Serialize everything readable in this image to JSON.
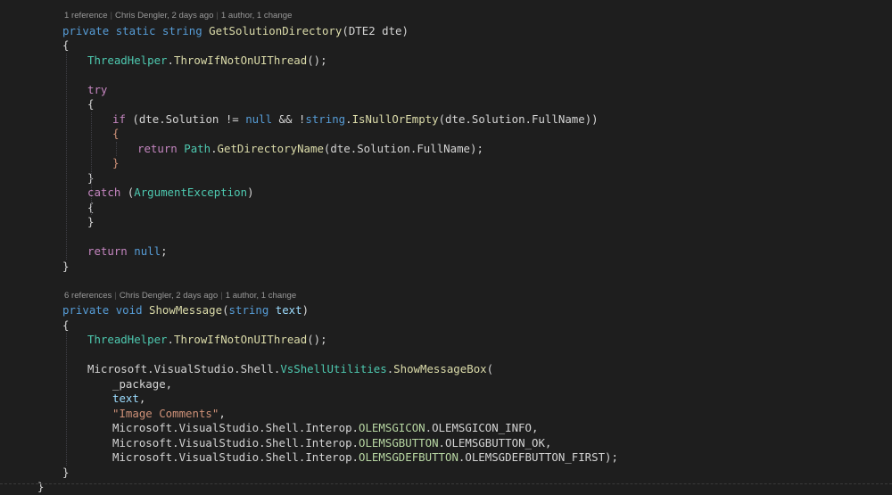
{
  "colors": {
    "background": "#1e1e1e",
    "keyword": "#569cd6",
    "control": "#c586c0",
    "type": "#4ec9b0",
    "enum": "#b8d7a3",
    "method": "#dcdcaa",
    "string": "#ce9178",
    "text": "#d4d4d4",
    "param": "#9cdcfe",
    "lens": "#999999"
  },
  "codelens": [
    {
      "refs": "1 reference",
      "author": "Chris Dengler, 2 days ago",
      "changes": "1 author, 1 change"
    },
    {
      "refs": "6 references",
      "author": "Chris Dengler, 2 days ago",
      "changes": "1 author, 1 change"
    }
  ],
  "lines": [
    {
      "lens": 0
    },
    {
      "indent": 0,
      "tokens": [
        [
          "private",
          "kw"
        ],
        [
          " ",
          "p"
        ],
        [
          "static",
          "kw"
        ],
        [
          " ",
          "p"
        ],
        [
          "string",
          "kw"
        ],
        [
          " ",
          "p"
        ],
        [
          "GetSolutionDirectory",
          "mt"
        ],
        [
          "(",
          "p"
        ],
        [
          "DTE2",
          "p"
        ],
        [
          " dte)",
          "p"
        ]
      ]
    },
    {
      "indent": 0,
      "tokens": [
        [
          "{",
          "p"
        ]
      ]
    },
    {
      "indent": 1,
      "tokens": [
        [
          "ThreadHelper",
          "ty"
        ],
        [
          ".",
          "p"
        ],
        [
          "ThrowIfNotOnUIThread",
          "mt"
        ],
        [
          "();",
          "p"
        ]
      ]
    },
    {
      "indent": 0,
      "tokens": []
    },
    {
      "indent": 1,
      "tokens": [
        [
          "try",
          "ct"
        ]
      ]
    },
    {
      "indent": 1,
      "tokens": [
        [
          "{",
          "p"
        ]
      ]
    },
    {
      "indent": 2,
      "tokens": [
        [
          "if",
          "ct"
        ],
        [
          " (dte.Solution != ",
          "p"
        ],
        [
          "null",
          "kw"
        ],
        [
          " && !",
          "p"
        ],
        [
          "string",
          "kw"
        ],
        [
          ".",
          "p"
        ],
        [
          "IsNullOrEmpty",
          "mt"
        ],
        [
          "(dte.Solution.FullName))",
          "p"
        ]
      ]
    },
    {
      "indent": 2,
      "tokens": [
        [
          "{",
          "br"
        ]
      ]
    },
    {
      "indent": 3,
      "tokens": [
        [
          "return",
          "ct"
        ],
        [
          " ",
          "p"
        ],
        [
          "Path",
          "ty"
        ],
        [
          ".",
          "p"
        ],
        [
          "GetDirectoryName",
          "mt"
        ],
        [
          "(dte.Solution.FullName);",
          "p"
        ]
      ]
    },
    {
      "indent": 2,
      "tokens": [
        [
          "}",
          "br"
        ]
      ]
    },
    {
      "indent": 1,
      "tokens": [
        [
          "}",
          "p"
        ]
      ]
    },
    {
      "indent": 1,
      "tokens": [
        [
          "catch",
          "ct"
        ],
        [
          " (",
          "p"
        ],
        [
          "ArgumentException",
          "ty"
        ],
        [
          ")",
          "p"
        ]
      ]
    },
    {
      "indent": 1,
      "tokens": [
        [
          "{",
          "p"
        ]
      ]
    },
    {
      "indent": 1,
      "tokens": [
        [
          "}",
          "p"
        ]
      ]
    },
    {
      "indent": 0,
      "tokens": []
    },
    {
      "indent": 1,
      "tokens": [
        [
          "return",
          "ct"
        ],
        [
          " ",
          "p"
        ],
        [
          "null",
          "kw"
        ],
        [
          ";",
          "p"
        ]
      ]
    },
    {
      "indent": 0,
      "tokens": [
        [
          "}",
          "p"
        ]
      ]
    },
    {
      "indent": 0,
      "tokens": []
    },
    {
      "lens": 1
    },
    {
      "indent": 0,
      "tokens": [
        [
          "private",
          "kw"
        ],
        [
          " ",
          "p"
        ],
        [
          "void",
          "kw"
        ],
        [
          " ",
          "p"
        ],
        [
          "ShowMessage",
          "mt"
        ],
        [
          "(",
          "p"
        ],
        [
          "string",
          "kw"
        ],
        [
          " ",
          "p"
        ],
        [
          "text",
          "pa"
        ],
        [
          ")",
          "p"
        ]
      ]
    },
    {
      "indent": 0,
      "tokens": [
        [
          "{",
          "p"
        ]
      ]
    },
    {
      "indent": 1,
      "tokens": [
        [
          "ThreadHelper",
          "ty"
        ],
        [
          ".",
          "p"
        ],
        [
          "ThrowIfNotOnUIThread",
          "mt"
        ],
        [
          "();",
          "p"
        ]
      ]
    },
    {
      "indent": 0,
      "tokens": []
    },
    {
      "indent": 1,
      "tokens": [
        [
          "Microsoft.VisualStudio.Shell.",
          "p"
        ],
        [
          "VsShellUtilities",
          "ty"
        ],
        [
          ".",
          "p"
        ],
        [
          "ShowMessageBox",
          "mt"
        ],
        [
          "(",
          "p"
        ]
      ]
    },
    {
      "indent": 2,
      "tokens": [
        [
          "_package,",
          "p"
        ]
      ]
    },
    {
      "indent": 2,
      "tokens": [
        [
          "text",
          "pa"
        ],
        [
          ",",
          "p"
        ]
      ]
    },
    {
      "indent": 2,
      "tokens": [
        [
          "\"Image Comments\"",
          "st"
        ],
        [
          ",",
          "p"
        ]
      ]
    },
    {
      "indent": 2,
      "tokens": [
        [
          "Microsoft.VisualStudio.Shell.Interop.",
          "p"
        ],
        [
          "OLEMSGICON",
          "en"
        ],
        [
          ".OLEMSGICON_INFO,",
          "p"
        ]
      ]
    },
    {
      "indent": 2,
      "tokens": [
        [
          "Microsoft.VisualStudio.Shell.Interop.",
          "p"
        ],
        [
          "OLEMSGBUTTON",
          "en"
        ],
        [
          ".OLEMSGBUTTON_OK,",
          "p"
        ]
      ]
    },
    {
      "indent": 2,
      "tokens": [
        [
          "Microsoft.VisualStudio.Shell.Interop.",
          "p"
        ],
        [
          "OLEMSGDEFBUTTON",
          "en"
        ],
        [
          ".OLEMSGDEFBUTTON_FIRST);",
          "p"
        ]
      ]
    },
    {
      "indent": 0,
      "tokens": [
        [
          "}",
          "p"
        ]
      ]
    },
    {
      "indent": -1,
      "tokens": [
        [
          "}",
          "p"
        ]
      ]
    }
  ]
}
